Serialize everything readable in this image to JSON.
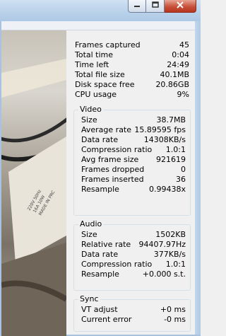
{
  "window": {
    "controls": {
      "minimize_icon": "minimize-icon",
      "maximize_icon": "maximize-icon",
      "close_icon": "close-icon"
    },
    "accent": "#b9d1ea",
    "close_color": "#c7503a"
  },
  "stats": [
    {
      "label": "Frames captured",
      "value": "45"
    },
    {
      "label": "Total time",
      "value": "0:04"
    },
    {
      "label": "Time left",
      "value": "24:49"
    },
    {
      "label": "Total file size",
      "value": "40.1MB"
    },
    {
      "label": "Disk space free",
      "value": "20.86GB"
    },
    {
      "label": "CPU usage",
      "value": "9%"
    }
  ],
  "video": {
    "title": "Video",
    "rows": [
      {
        "label": "Size",
        "value": "38.7MB"
      },
      {
        "label": "Average rate",
        "value": "15.89595 fps"
      },
      {
        "label": "Data rate",
        "value": "14308KB/s"
      },
      {
        "label": "Compression ratio",
        "value": "1.0:1"
      },
      {
        "label": "Avg frame size",
        "value": "921619"
      },
      {
        "label": "Frames dropped",
        "value": "0"
      },
      {
        "label": "Frames inserted",
        "value": "36"
      },
      {
        "label": "Resample",
        "value": "0.99438x"
      }
    ]
  },
  "audio": {
    "title": "Audio",
    "rows": [
      {
        "label": "Size",
        "value": "1502KB"
      },
      {
        "label": "Relative rate",
        "value": "94407.97Hz"
      },
      {
        "label": "Data rate",
        "value": "377KB/s"
      },
      {
        "label": "Compression ratio",
        "value": "1.0:1"
      },
      {
        "label": "Resample",
        "value": "+0.000 s.t."
      }
    ]
  },
  "sync": {
    "title": "Sync",
    "rows": [
      {
        "label": "VT adjust",
        "value": "+0 ms"
      },
      {
        "label": "Current error",
        "value": "-0 ms"
      }
    ]
  },
  "preview": {
    "label_text": [
      "220V 50Hz",
      "16A 10W",
      "MADE IN PRC"
    ]
  }
}
